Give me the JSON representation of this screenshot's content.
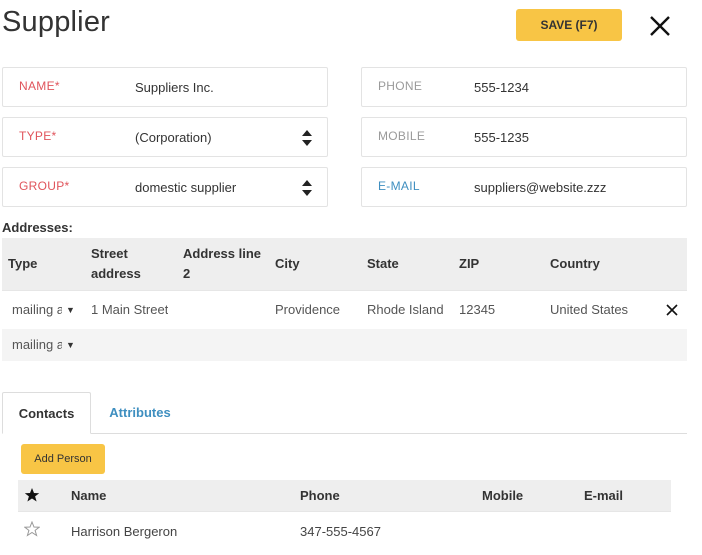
{
  "header": {
    "title": "Supplier",
    "save_label": "SAVE (F7)"
  },
  "form": {
    "name_label": "NAME*",
    "name_value": "Suppliers Inc.",
    "type_label": "TYPE*",
    "type_value": "(Corporation)",
    "group_label": "GROUP*",
    "group_value": "domestic supplier",
    "phone_label": "PHONE",
    "phone_value": "555-1234",
    "mobile_label": "MOBILE",
    "mobile_value": "555-1235",
    "email_label": "E-MAIL",
    "email_value": "suppliers@website.zzz"
  },
  "addresses": {
    "label": "Addresses:",
    "columns": [
      "Type",
      "Street address",
      "Address line 2",
      "City",
      "State",
      "ZIP",
      "Country"
    ],
    "rows": [
      {
        "type": "mailing a",
        "street": "1 Main Street",
        "line2": "",
        "city": "Providence",
        "state": "Rhode Island",
        "zip": "12345",
        "country": "United States"
      }
    ],
    "new_row_type": "mailing a"
  },
  "tabs": [
    {
      "label": "Contacts",
      "active": true
    },
    {
      "label": "Attributes",
      "active": false
    }
  ],
  "contacts": {
    "add_label": "Add Person",
    "columns": [
      "Name",
      "Phone",
      "Mobile",
      "E-mail"
    ],
    "rows": [
      {
        "name": "Harrison Bergeron",
        "phone": "347-555-4567",
        "mobile": "",
        "email": ""
      }
    ]
  },
  "colors": {
    "accent_yellow": "#f8c545",
    "required_red": "#e0545b",
    "link_blue": "#3f8fc0"
  }
}
